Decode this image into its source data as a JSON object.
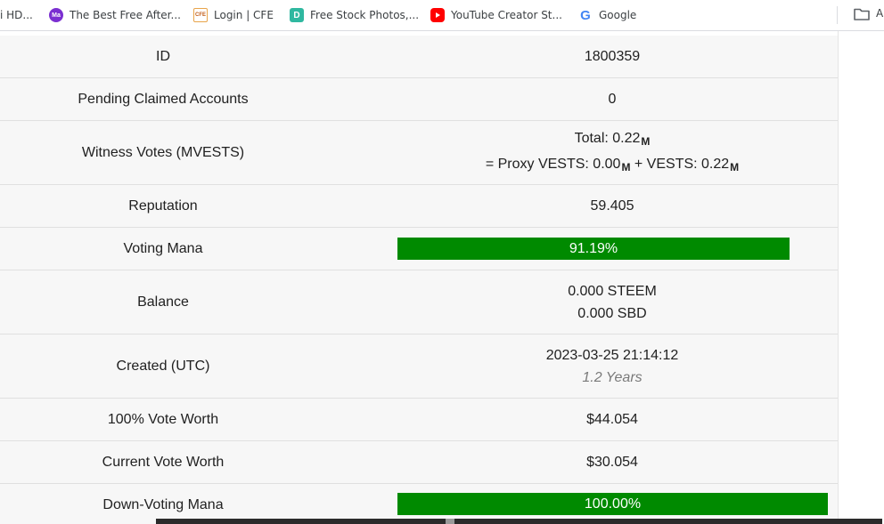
{
  "bookmarks": [
    {
      "label": "i HD...",
      "icon": "none"
    },
    {
      "label": "The Best Free After...",
      "icon": "ma-logo-icon",
      "badge": "Ma"
    },
    {
      "label": "Login | CFE",
      "icon": "cfe-logo-icon",
      "badge": "CFE"
    },
    {
      "label": "Free Stock Photos,...",
      "icon": "d-logo-icon",
      "badge": "D"
    },
    {
      "label": "YouTube Creator St...",
      "icon": "youtube-icon"
    },
    {
      "label": "Google",
      "icon": "google-icon",
      "badge": "G"
    }
  ],
  "bookmarks_overflow": "A",
  "colors": {
    "bar_green": "#008a00",
    "row_bg": "#f7f7f7",
    "border": "#e0e0e0"
  },
  "rows": {
    "id": {
      "label": "ID",
      "value": "1800359"
    },
    "pending": {
      "label": "Pending Claimed Accounts",
      "value": "0"
    },
    "witness": {
      "label": "Witness Votes (MVESTS)",
      "line1_prefix": "Total: 0.22",
      "line2_a": "= Proxy VESTS: 0.00",
      "line2_b": " + VESTS: 0.22",
      "unit": "M"
    },
    "reputation": {
      "label": "Reputation",
      "value": "59.405"
    },
    "voting_mana": {
      "label": "Voting Mana",
      "value": "91.19%",
      "fraction": 0.9119
    },
    "balance": {
      "label": "Balance",
      "line1": "0.000 STEEM",
      "line2": "0.000 SBD"
    },
    "created": {
      "label": "Created (UTC)",
      "line1": "2023-03-25 21:14:12",
      "line2": "1.2 Years"
    },
    "vote_worth": {
      "label": "100% Vote Worth",
      "value": "$44.054"
    },
    "current_vote": {
      "label": "Current Vote Worth",
      "value": "$30.054"
    },
    "down_mana": {
      "label": "Down-Voting Mana",
      "value": "100.00%",
      "fraction": 1.0
    }
  }
}
